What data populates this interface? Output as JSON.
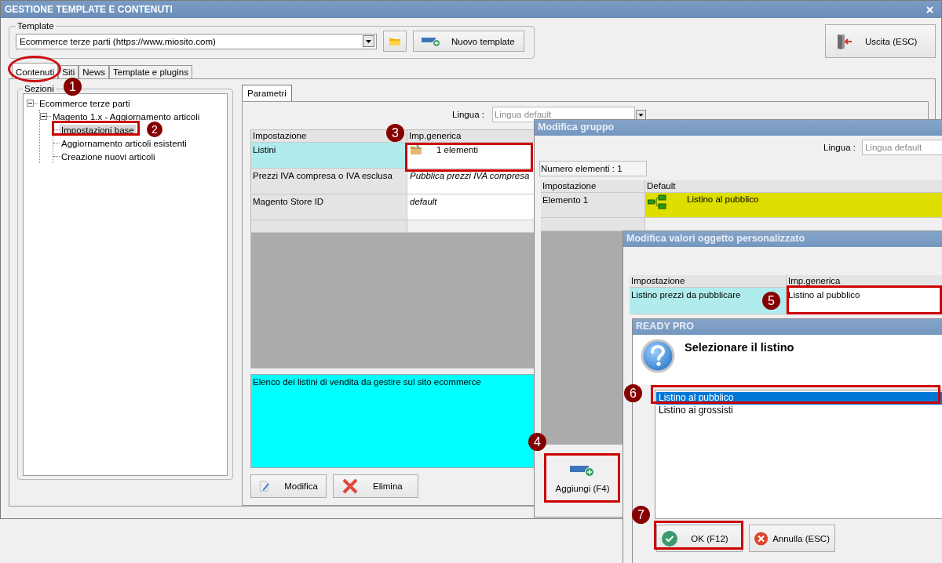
{
  "main_window": {
    "title": "GESTIONE TEMPLATE E CONTENUTI",
    "template": {
      "label": "Template",
      "value": "Ecommerce terze parti (https://www.miosito.com)"
    },
    "new_template_button": "Nuovo template",
    "exit_button": "Uscita (ESC)",
    "tabs": [
      {
        "label": "Contenuti",
        "selected": true
      },
      {
        "label": "Siti",
        "selected": false
      },
      {
        "label": "News",
        "selected": false
      },
      {
        "label": "Template e plugins",
        "selected": false
      }
    ],
    "sections": {
      "label": "Sezioni",
      "tree": [
        {
          "label": "Ecommerce terze parti",
          "expanded": true,
          "selected": false,
          "children": [
            {
              "label": "Magento 1.x - Aggiornamento articoli",
              "expanded": true,
              "selected": false,
              "children": [
                {
                  "label": "Impostazioni base",
                  "selected": true
                },
                {
                  "label": "Aggiornamento articoli esistenti",
                  "selected": false
                },
                {
                  "label": "Creazione nuovi articoli",
                  "selected": false
                }
              ]
            }
          ]
        }
      ]
    },
    "panel_tabs": [
      {
        "label": "Parametri",
        "selected": true
      }
    ],
    "language": {
      "label": "Lingua :",
      "placeholder": "Lingua default"
    },
    "grid": {
      "columns": [
        "Impostazione",
        "Imp.generica"
      ],
      "rows": [
        {
          "setting": "Listini",
          "value": "1 elementi",
          "kind": "group",
          "selected": true
        },
        {
          "setting": "Prezzi IVA compresa o IVA esclusa",
          "value": "Pubblica prezzi IVA compresa",
          "kind": "text",
          "selected": false
        },
        {
          "setting": "Magento Store ID",
          "value": "default",
          "kind": "text",
          "selected": false
        }
      ]
    },
    "description": "Elenco dei listini di vendita da gestire sul sito ecommerce",
    "edit_button": "Modifica",
    "delete_button": "Elimina"
  },
  "group_dialog": {
    "title": "Modifica gruppo",
    "language": {
      "label": "Lingua :",
      "placeholder": "Lingua default"
    },
    "count": "Numero elementi : 1",
    "columns": [
      "Impostazione",
      "Default"
    ],
    "rows": [
      {
        "setting": "Elemento 1",
        "value": "Listino al pubblico",
        "selected": true
      }
    ],
    "add_button": "Aggiungi (F4)"
  },
  "custom_dialog": {
    "title": "Modifica valori oggetto personalizzato",
    "columns": [
      "Impostazione",
      "Imp.generica"
    ],
    "rows": [
      {
        "setting": "Listino prezzi da pubblicare",
        "value": "Listino al pubblico",
        "selected": true
      }
    ]
  },
  "message_dialog": {
    "title": "READY PRO",
    "heading": "Selezionare il listino",
    "options": [
      {
        "label": "Listino al pubblico",
        "selected": true
      },
      {
        "label": "Listino ai grossisti",
        "selected": false
      }
    ],
    "ok_button": "OK (F12)",
    "cancel_button": "Annulla (ESC)"
  },
  "annotations": [
    {
      "number": "1"
    },
    {
      "number": "2"
    },
    {
      "number": "3"
    },
    {
      "number": "4"
    },
    {
      "number": "5"
    },
    {
      "number": "6"
    },
    {
      "number": "7"
    }
  ]
}
